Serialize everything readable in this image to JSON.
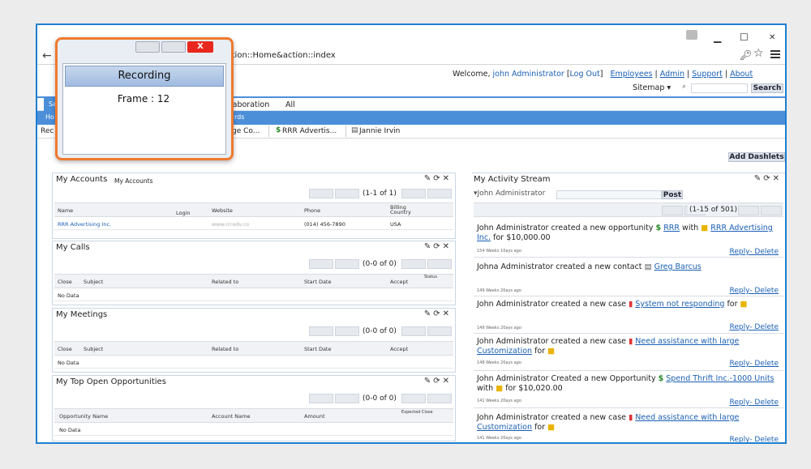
{
  "browser": {
    "url_fragment": "action::Home&action::index",
    "controls": {
      "minimize": "▁",
      "maximize": "☐",
      "close": "✕"
    }
  },
  "recorder": {
    "close_label": "X",
    "status": "Recording",
    "frame": "Frame : 12"
  },
  "header": {
    "welcome": "Welcome,",
    "user": "john Administrator",
    "logout": "Log Out",
    "links": [
      "Employees",
      "Admin",
      "Support",
      "About"
    ],
    "sitemap": "Sitemap",
    "search_button": "Search",
    "search_placeholder": ""
  },
  "nav": {
    "tabs": [
      "laboration",
      "All"
    ],
    "sub_tab": "rds",
    "home_short": "Ho",
    "sa_short": "Sa"
  },
  "recent": {
    "prefix": "Rec",
    "items": [
      "ge Co...",
      "RRR Advertis...",
      "Jannie Irvin"
    ]
  },
  "dashboard": {
    "add_dashlets": "Add Dashlets"
  },
  "accounts": {
    "title": "My Accounts",
    "subtitle": "My Accounts",
    "pager": "(1-1 of 1)",
    "columns": [
      "Name",
      "Login",
      "Website",
      "Phone",
      "Billing Country"
    ],
    "rows": [
      {
        "name": "RRR Advertising Inc.",
        "website": "www.rrradv.co",
        "phone": "(014) 456-7890",
        "country": "USA"
      }
    ]
  },
  "calls": {
    "title": "My Calls",
    "pager": "(0-0 of 0)",
    "columns": [
      "Close",
      "Subject",
      "Related to",
      "Start Date",
      "Accept",
      "Status"
    ],
    "empty": "No Data"
  },
  "meetings": {
    "title": "My Meetings",
    "pager": "(0-0 of 0)",
    "columns": [
      "Close",
      "Subject",
      "Related to",
      "Start Date",
      "Accept"
    ],
    "empty": "No Data"
  },
  "opportunities": {
    "title": "My Top Open Opportunities",
    "pager": "(0-0 of 0)",
    "columns": [
      "Opportunity Name",
      "Account Name",
      "Amount",
      "Expected Close"
    ],
    "empty": "No Data"
  },
  "activity": {
    "title": "My Activity Stream",
    "user": "John Administrator",
    "post_button": "Post",
    "pager": "(1-15 of 501)",
    "reply_delete": "Reply- Delete",
    "items": [
      {
        "text": "John Administrator created a new opportunity",
        "link": "RRR Advertising Inc.",
        "mid": "with",
        "tail": "for $10,000.00",
        "ago": "154 Weeks 10ays ago",
        "link2": "RRR"
      },
      {
        "text": "Johna Administrator created a new contact",
        "link": "Greg Barcus",
        "ago": "149 Weeks 20ays ago"
      },
      {
        "text": "John Administrator created a new case",
        "link": "System not responding",
        "tail": "for",
        "ago": "149 Weeks 20ays ago"
      },
      {
        "text": "John Administrator created a new case",
        "link": "Need assistance with large Customization",
        "tail": "for",
        "ago": "148 Weeks 20ays ago"
      },
      {
        "text": "John Administrator Created a new Opportunity",
        "link": "Spend Thrift Inc.-1000 Units",
        "tail": "with",
        "tail2": "for $10,020.00",
        "ago": "141 Weeks 20ays ago"
      },
      {
        "text": "John Administrator created a new case",
        "link": "Need assistance with large Customization",
        "tail": "for",
        "ago": "141 Weeks 20ays ago"
      }
    ]
  }
}
